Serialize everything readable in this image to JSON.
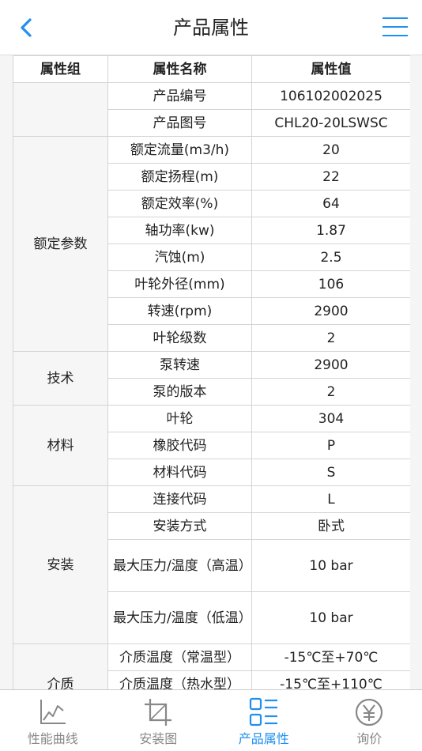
{
  "header": {
    "title": "产品属性"
  },
  "table": {
    "headers": [
      "属性组",
      "属性名称",
      "属性值"
    ],
    "groups": [
      {
        "name": "",
        "rows": [
          {
            "name": "产品编号",
            "value": "106102002025"
          },
          {
            "name": "产品图号",
            "value": "CHL20-20LSWSC"
          }
        ]
      },
      {
        "name": "额定参数",
        "rows": [
          {
            "name": "额定流量(m3/h)",
            "value": "20"
          },
          {
            "name": "额定扬程(m)",
            "value": "22"
          },
          {
            "name": "额定效率(%)",
            "value": "64"
          },
          {
            "name": "轴功率(kw)",
            "value": "1.87"
          },
          {
            "name": "汽蚀(m)",
            "value": "2.5"
          },
          {
            "name": "叶轮外径(mm)",
            "value": "106"
          },
          {
            "name": "转速(rpm)",
            "value": "2900"
          },
          {
            "name": "叶轮级数",
            "value": "2"
          }
        ]
      },
      {
        "name": "技术",
        "rows": [
          {
            "name": "泵转速",
            "value": "2900"
          },
          {
            "name": "泵的版本",
            "value": "2"
          }
        ]
      },
      {
        "name": "材料",
        "rows": [
          {
            "name": "叶轮",
            "value": "304"
          },
          {
            "name": "橡胶代码",
            "value": "P"
          },
          {
            "name": "材料代码",
            "value": "S"
          }
        ]
      },
      {
        "name": "安装",
        "rows": [
          {
            "name": "连接代码",
            "value": "L"
          },
          {
            "name": "安装方式",
            "value": "卧式"
          },
          {
            "name": "最大压力/温度（高温）",
            "value": "10 bar"
          },
          {
            "name": "最大压力/温度（低温）",
            "value": "10 bar"
          }
        ]
      },
      {
        "name": "介质",
        "rows": [
          {
            "name": "介质温度（常温型）",
            "value": "-15℃至+70℃"
          },
          {
            "name": "介质温度（热水型）",
            "value": "-15℃至+110℃"
          }
        ]
      }
    ]
  },
  "nav": {
    "items": [
      {
        "label": "性能曲线",
        "icon": "chart-line-icon",
        "active": false
      },
      {
        "label": "安装图",
        "icon": "crop-frame-icon",
        "active": false
      },
      {
        "label": "产品属性",
        "icon": "list-icon",
        "active": true
      },
      {
        "label": "询价",
        "icon": "yen-icon",
        "active": false
      }
    ],
    "active_color": "#1f8ff0",
    "inactive_color": "#888888"
  }
}
